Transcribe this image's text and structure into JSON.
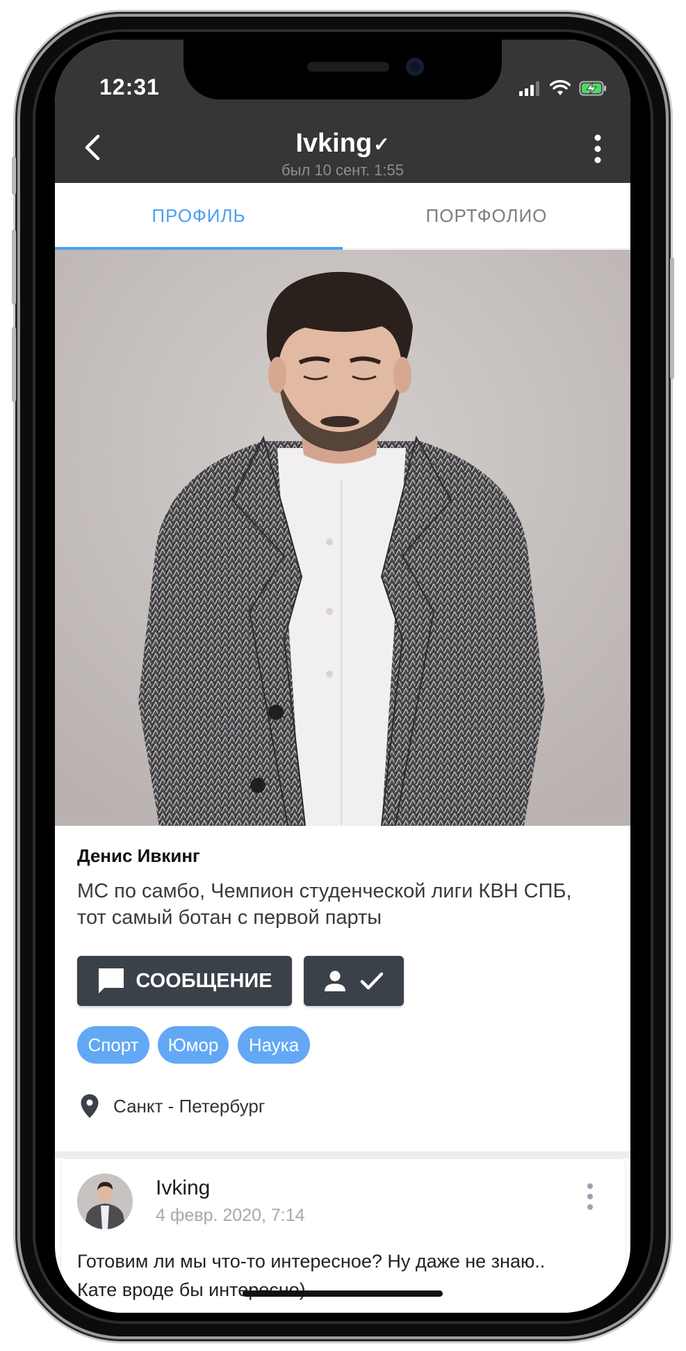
{
  "status_bar": {
    "time": "12:31"
  },
  "header": {
    "title": "Ivking",
    "verified_mark": "✓",
    "subtitle": "был 10 сент. 1:55"
  },
  "tabs": [
    {
      "label": "ПРОФИЛЬ",
      "active": true
    },
    {
      "label": "ПОРТФОЛИО",
      "active": false
    }
  ],
  "profile": {
    "name": "Денис Ивкинг",
    "bio": "МС по самбо, Чемпион студенческой лиги КВН СПБ, тот самый ботан с первой парты",
    "message_button": "СООБЩЕНИЕ",
    "tags": [
      "Спорт",
      "Юмор",
      "Наука"
    ],
    "location": "Санкт - Петербург"
  },
  "post": {
    "author": "Ivking",
    "date": "4 февр. 2020, 7:14",
    "text_line1": "Готовим ли мы что-то интересное? Ну даже не знаю..",
    "text_line2": "Кате вроде бы интересно)"
  },
  "colors": {
    "header_bg": "#363638",
    "accent": "#4a9ff0",
    "tag_bg": "#62a8f5",
    "button_bg": "#3a4148"
  },
  "icons": {
    "back": "chevron-left-icon",
    "more": "more-vertical-icon",
    "message": "message-icon",
    "friend": "person-check-icon",
    "location": "location-pin-icon"
  }
}
